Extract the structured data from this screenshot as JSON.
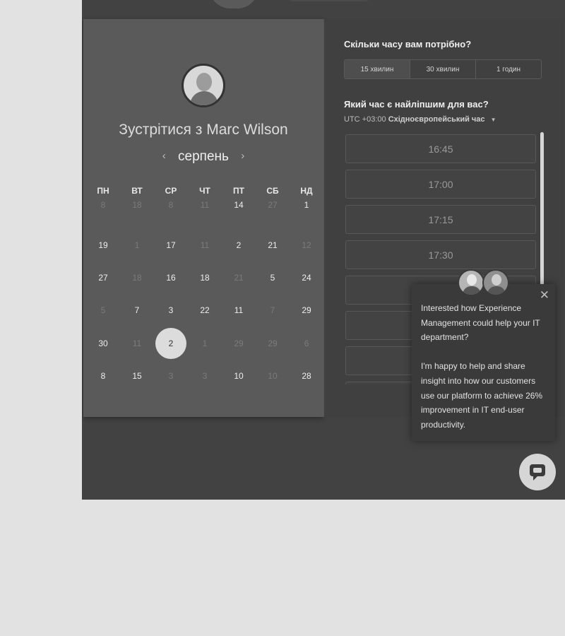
{
  "booking": {
    "title": "Зустрітися з Marc Wilson",
    "calendar": {
      "month": "серпень",
      "prev_icon": "‹",
      "next_icon": "›",
      "weekdays": [
        "ПН",
        "ВТ",
        "СР",
        "ЧТ",
        "ПТ",
        "СБ",
        "НД"
      ],
      "days": [
        {
          "label": "8",
          "muted": true
        },
        {
          "label": "18",
          "muted": true
        },
        {
          "label": "8",
          "muted": true
        },
        {
          "label": "11",
          "muted": true
        },
        {
          "label": "14",
          "muted": false
        },
        {
          "label": "27",
          "muted": true
        },
        {
          "label": "1",
          "muted": false
        },
        {
          "label": "19",
          "muted": false
        },
        {
          "label": "1",
          "muted": true
        },
        {
          "label": "17",
          "muted": false
        },
        {
          "label": "11",
          "muted": true
        },
        {
          "label": "2",
          "muted": false
        },
        {
          "label": "21",
          "muted": false
        },
        {
          "label": "12",
          "muted": true
        },
        {
          "label": "27",
          "muted": false
        },
        {
          "label": "18",
          "muted": true
        },
        {
          "label": "16",
          "muted": false
        },
        {
          "label": "18",
          "muted": false
        },
        {
          "label": "21",
          "muted": true
        },
        {
          "label": "5",
          "muted": false
        },
        {
          "label": "24",
          "muted": false
        },
        {
          "label": "5",
          "muted": true
        },
        {
          "label": "7",
          "muted": false
        },
        {
          "label": "3",
          "muted": false
        },
        {
          "label": "22",
          "muted": false
        },
        {
          "label": "11",
          "muted": false
        },
        {
          "label": "7",
          "muted": true
        },
        {
          "label": "29",
          "muted": false
        },
        {
          "label": "30",
          "muted": false
        },
        {
          "label": "11",
          "muted": true
        },
        {
          "label": "2",
          "muted": false,
          "selected": true
        },
        {
          "label": "1",
          "muted": true
        },
        {
          "label": "29",
          "muted": true
        },
        {
          "label": "29",
          "muted": true
        },
        {
          "label": "6",
          "muted": true
        },
        {
          "label": "8",
          "muted": false
        },
        {
          "label": "15",
          "muted": false
        },
        {
          "label": "3",
          "muted": true
        },
        {
          "label": "3",
          "muted": true
        },
        {
          "label": "10",
          "muted": false
        },
        {
          "label": "10",
          "muted": true
        },
        {
          "label": "28",
          "muted": false
        }
      ]
    },
    "duration": {
      "title": "Скільки часу вам потрібно?",
      "options": [
        "15 хвилин",
        "30 хвилин",
        "1 годин"
      ],
      "selected_index": 0
    },
    "time": {
      "title": "Який час є найліпшим для вас?",
      "timezone_offset": "UTC +03:00",
      "timezone_name": "Східноєвропейський час",
      "timezone_caret": "▼",
      "slots": [
        "16:45",
        "17:00",
        "17:15",
        "17:30",
        "",
        "",
        "",
        ""
      ]
    }
  },
  "chat_popup": {
    "close_icon": "✕",
    "message_1": "Interested how Experience Management could help your IT department?",
    "message_2": "I'm happy to help and share insight into how our customers use our platform to achieve 26% improvement in IT end-user productivity."
  },
  "icons": {
    "chat_launcher": "chat-bubble-icon",
    "avatar": "person-avatar"
  },
  "colors": {
    "page_background": "#e2e2e2",
    "frame_background": "#424242",
    "calendar_panel": "#5a5a5a",
    "selected_day": "#dcdcdc"
  }
}
